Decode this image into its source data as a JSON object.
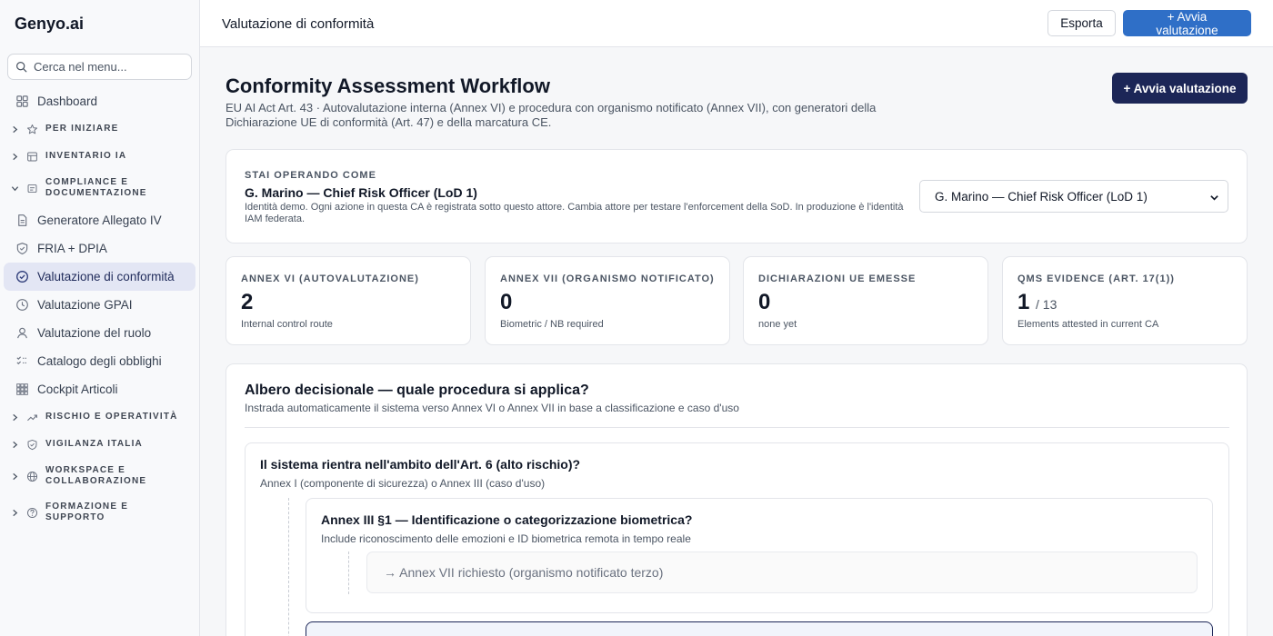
{
  "app": {
    "brand": "Genyo.ai"
  },
  "sidebar": {
    "search_placeholder": "Cerca nel menu...",
    "dashboard": "Dashboard",
    "groups": {
      "per_iniziare": "PER INIZIARE",
      "inventario": "INVENTARIO IA",
      "compliance_line1": "COMPLIANCE E",
      "compliance_line2": "DOCUMENTAZIONE",
      "rischio": "RISCHIO E OPERATIVITÀ",
      "vigilanza": "VIGILANZA ITALIA",
      "workspace_line1": "WORKSPACE E",
      "workspace_line2": "COLLABORAZIONE",
      "formazione_line1": "FORMAZIONE E",
      "formazione_line2": "SUPPORTO"
    },
    "items": [
      {
        "label": "Generatore Allegato IV",
        "icon": "document-icon"
      },
      {
        "label": "FRIA + DPIA",
        "icon": "shield-icon"
      },
      {
        "label": "Valutazione di conformità",
        "icon": "check-circle-icon",
        "active": true
      },
      {
        "label": "Valutazione GPAI",
        "icon": "clock-icon"
      },
      {
        "label": "Valutazione del ruolo",
        "icon": "user-icon"
      },
      {
        "label": "Catalogo degli obblighi",
        "icon": "checklist-icon"
      },
      {
        "label": "Cockpit Articoli",
        "icon": "grid-icon"
      }
    ]
  },
  "topbar": {
    "title": "Valutazione di conformità",
    "export_label": "Esporta",
    "start_label": "+ Avvia valutazione"
  },
  "page": {
    "title": "Conformity Assessment Workflow",
    "subtitle": "EU AI Act Art. 43 · Autovalutazione interna (Annex VI) e procedura con organismo notificato (Annex VII), con generatori della Dichiarazione UE di conformità (Art. 47) e della marcatura CE.",
    "start_label": "+ Avvia valutazione"
  },
  "actor": {
    "eyebrow": "STAI OPERANDO COME",
    "name": "G. Marino — Chief Risk Officer (LoD 1)",
    "note": "Identità demo. Ogni azione in questa CA è registrata sotto questo attore. Cambia attore per testare l'enforcement della SoD. In produzione è l'identità IAM federata.",
    "selected": "G. Marino — Chief Risk Officer (LoD 1)"
  },
  "stats": [
    {
      "label": "ANNEX VI (AUTOVALUTAZIONE)",
      "value": "2",
      "caption": "Internal control route"
    },
    {
      "label": "ANNEX VII (ORGANISMO NOTIFICATO)",
      "value": "0",
      "caption": "Biometric / NB required"
    },
    {
      "label": "DICHIARAZIONI UE EMESSE",
      "value": "0",
      "caption": "none yet"
    },
    {
      "label": "QMS EVIDENCE (ART. 17(1))",
      "value": "1",
      "of": "/ 13",
      "caption": "Elements attested in current CA"
    }
  ],
  "tree": {
    "title": "Albero decisionale — quale procedura si applica?",
    "subtitle": "Instrada automaticamente il sistema verso Annex VI o Annex VII in base a classificazione e caso d'uso",
    "q1": "Il sistema rientra nell'ambito dell'Art. 6 (alto rischio)?",
    "q1_desc": "Annex I (componente di sicurezza) o Annex III (caso d'uso)",
    "q2": "Annex III §1 — Identificazione o categorizzazione biometrica?",
    "q2_desc": "Include riconoscimento delle emozioni e ID biometrica remota in tempo reale",
    "result": "→ Annex VII richiesto (organismo notificato terzo)"
  }
}
